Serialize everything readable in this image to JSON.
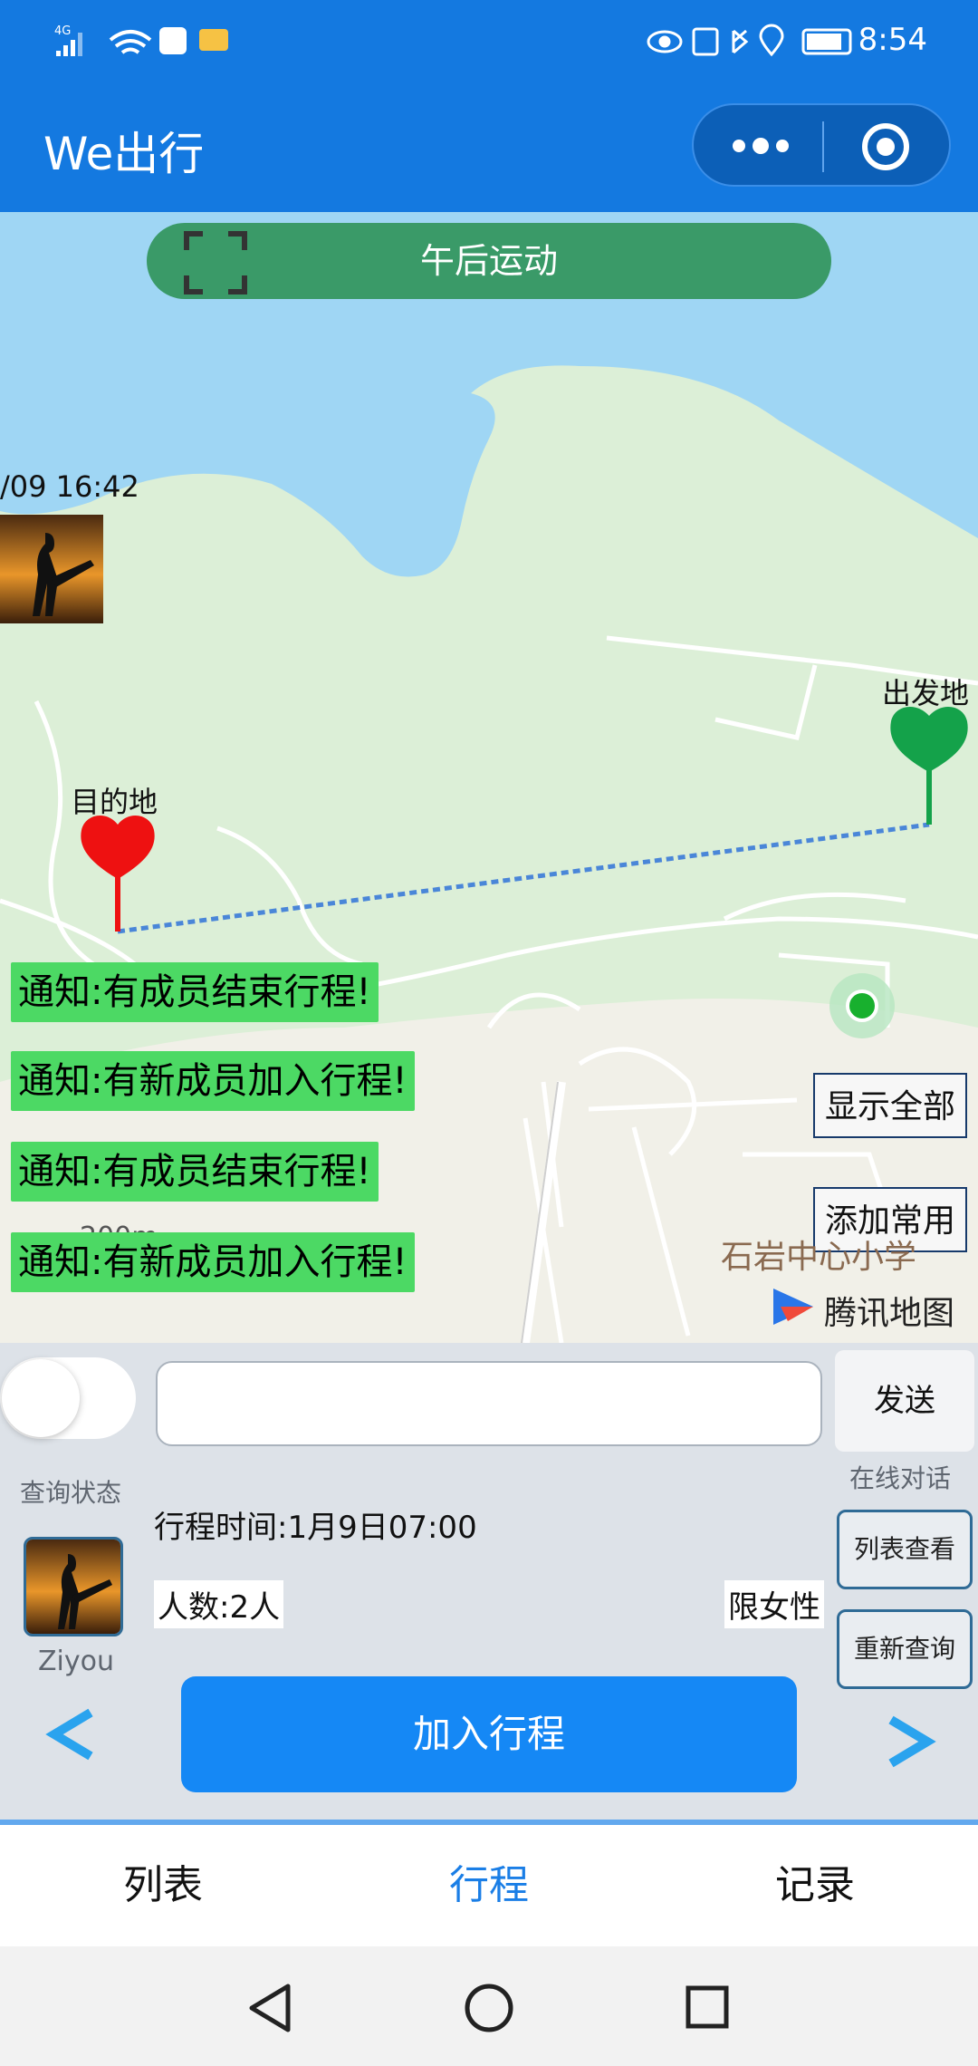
{
  "status_bar": {
    "network": "4G",
    "time": "8:54"
  },
  "app": {
    "title": "We出行"
  },
  "map": {
    "trip_name": "午后运动",
    "member_time": "/09 16:42",
    "destination_label": "目的地",
    "origin_label": "出发地",
    "notices": [
      "通知:有成员结束行程!",
      "通知:有新成员加入行程!",
      "通知:有成员结束行程!",
      "通知:有新成员加入行程!"
    ],
    "show_all_label": "显示全部",
    "add_favorite_label": "添加常用",
    "poi_label": "石岩中心小学",
    "scale_label": "200m",
    "provider_label": "腾讯地图",
    "colors": {
      "water": "#9fd6f4",
      "land": "#dcefd7",
      "urban": "#f1f0e8",
      "route": "#4a86d8",
      "destination_marker": "#ee1111",
      "origin_marker": "#14a24a"
    }
  },
  "chat": {
    "input_value": "",
    "send_label": "发送",
    "online_label": "在线对话",
    "query_status_label": "查询状态"
  },
  "trip": {
    "user_name": "Ziyou",
    "time_text": "行程时间:1月9日07:00",
    "count_text": "人数:2人",
    "restriction_text": "限女性",
    "list_view_label": "列表查看",
    "requery_label": "重新查询",
    "join_label": "加入行程",
    "prev_icon": "chevron-left-icon",
    "next_icon": "chevron-right-icon"
  },
  "tabs": [
    {
      "label": "列表",
      "active": false
    },
    {
      "label": "行程",
      "active": true
    },
    {
      "label": "记录",
      "active": false
    }
  ]
}
